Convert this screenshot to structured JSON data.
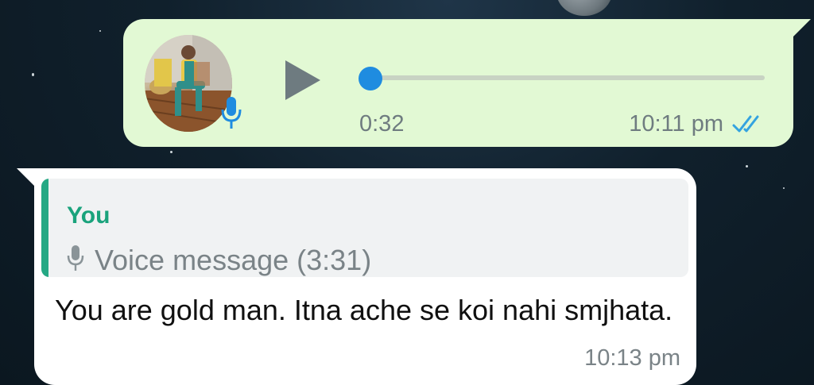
{
  "outgoing_voice": {
    "duration": "0:32",
    "time": "10:11 pm",
    "status": "read",
    "progress_fraction": 0.0,
    "accent_color": "#1f8ce0"
  },
  "incoming_reply": {
    "quote_author": "You",
    "quote_text": "Voice message (3:31)",
    "text": "You are gold man. Itna ache se koi nahi smjhata.",
    "time": "10:13 pm"
  },
  "icons": {
    "play": "play-icon",
    "mic": "mic-icon",
    "read": "double-check-icon"
  },
  "colors": {
    "outgoing_bubble": "#e2f9d4",
    "incoming_bubble": "#ffffff",
    "quote_accent": "#25a884",
    "read_ticks": "#34a3e0"
  }
}
